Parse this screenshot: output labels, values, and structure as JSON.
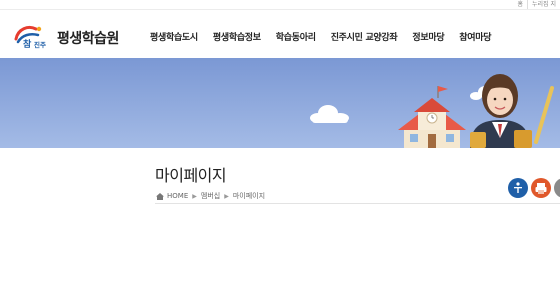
{
  "util_links": [
    "홈",
    "누리집 지"
  ],
  "header": {
    "site_title": "평생학습원",
    "logo_text": "참진주"
  },
  "nav": [
    "평생학습도시",
    "평생학습정보",
    "학습동아리",
    "진주시민 교양강좌",
    "정보마당",
    "참여마당"
  ],
  "page": {
    "title": "마이페이지",
    "breadcrumb": [
      "HOME",
      "멤버십",
      "마이페이지"
    ]
  },
  "quick_buttons": [
    {
      "icon": "accessibility-icon",
      "color": "#1f5fa8"
    },
    {
      "icon": "print-icon",
      "color": "#e0582b"
    },
    {
      "icon": "share-icon",
      "color": "#8a8a8a"
    }
  ],
  "colors": {
    "sky": "#7b98d4",
    "building_roof": "#e85a48",
    "building_wall": "#f4e7cf"
  }
}
